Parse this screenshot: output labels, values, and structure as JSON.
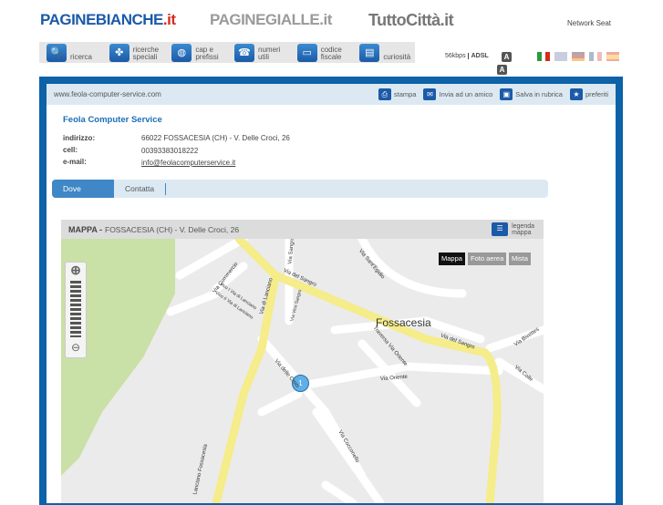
{
  "header": {
    "logo1_main": "PAGINEBIANCHE",
    "logo1_tld": ".it",
    "logo2": "PAGINEGIALLE.it",
    "logo3": "TuttoCittà.it",
    "network": "Network Seat"
  },
  "nav": [
    {
      "icon": "search-icon",
      "glyph": "🔍",
      "l1": "ricerca",
      "l2": ""
    },
    {
      "icon": "clover-icon",
      "glyph": "✤",
      "l1": "ricerche",
      "l2": "speciali"
    },
    {
      "icon": "globe-icon",
      "glyph": "◍",
      "l1": "cap e",
      "l2": "prefissi"
    },
    {
      "icon": "phone-icon",
      "glyph": "☎",
      "l1": "numeri",
      "l2": "utili"
    },
    {
      "icon": "card-icon",
      "glyph": "▭",
      "l1": "codice",
      "l2": "fiscale"
    },
    {
      "icon": "book-icon",
      "glyph": "▤",
      "l1": "curiosità",
      "l2": ""
    }
  ],
  "speed": {
    "slow": "56kbps",
    "fast": "ADSL"
  },
  "font_sizes": [
    "A",
    "A"
  ],
  "toolbar": {
    "url": "www.feola-computer-service.com",
    "actions": [
      "stampa",
      "Invia ad un amico",
      "Salva in rubrica",
      "preferiti"
    ]
  },
  "business": {
    "name": "Feola Computer Service",
    "address_label": "indirizzo:",
    "address": "66022 FOSSACESIA (CH) - V. Delle Croci, 26",
    "cell_label": "cell:",
    "cell": "00393383018222",
    "email_label": "e-mail:",
    "email": "info@feolacomputerservice.it"
  },
  "tabs": [
    "Dove Siamo",
    "Contatta"
  ],
  "map": {
    "title": "MAPPA -",
    "location": "FOSSACESIA (CH) - V. Delle Croci, 26",
    "legend1": "legenda",
    "legend2": "mappa",
    "types": [
      "Mappa",
      "Foto aerea",
      "Mista"
    ],
    "town": "Fossacesia",
    "marker": "1",
    "streets": [
      "Via Commercio",
      "Via del Sangro",
      "Via del Sangro",
      "Via Sant'Egidio",
      "Via di Lanciano",
      "Via Sangro",
      "Traversa Via Oriente",
      "Via Oriente",
      "Via delle Croci",
      "Via Cocconello",
      "Via Colle",
      "Via Bivettes",
      "Lanciano Fossacesia",
      "Vico I Via di Lanciano",
      "Vico II Via di Lanciano",
      "Via Vico Sangro"
    ]
  }
}
